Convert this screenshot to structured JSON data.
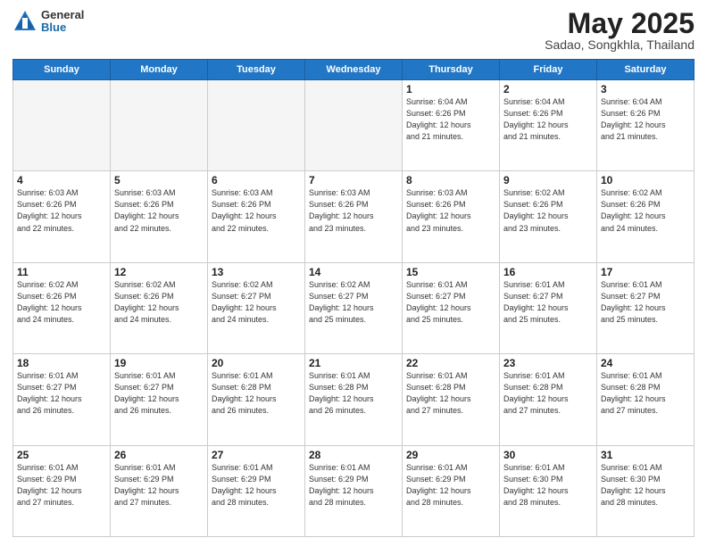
{
  "logo": {
    "general": "General",
    "blue": "Blue"
  },
  "title": {
    "month": "May 2025",
    "location": "Sadao, Songkhla, Thailand"
  },
  "weekdays": [
    "Sunday",
    "Monday",
    "Tuesday",
    "Wednesday",
    "Thursday",
    "Friday",
    "Saturday"
  ],
  "rows": [
    [
      {
        "day": "",
        "info": ""
      },
      {
        "day": "",
        "info": ""
      },
      {
        "day": "",
        "info": ""
      },
      {
        "day": "",
        "info": ""
      },
      {
        "day": "1",
        "info": "Sunrise: 6:04 AM\nSunset: 6:26 PM\nDaylight: 12 hours\nand 21 minutes."
      },
      {
        "day": "2",
        "info": "Sunrise: 6:04 AM\nSunset: 6:26 PM\nDaylight: 12 hours\nand 21 minutes."
      },
      {
        "day": "3",
        "info": "Sunrise: 6:04 AM\nSunset: 6:26 PM\nDaylight: 12 hours\nand 21 minutes."
      }
    ],
    [
      {
        "day": "4",
        "info": "Sunrise: 6:03 AM\nSunset: 6:26 PM\nDaylight: 12 hours\nand 22 minutes."
      },
      {
        "day": "5",
        "info": "Sunrise: 6:03 AM\nSunset: 6:26 PM\nDaylight: 12 hours\nand 22 minutes."
      },
      {
        "day": "6",
        "info": "Sunrise: 6:03 AM\nSunset: 6:26 PM\nDaylight: 12 hours\nand 22 minutes."
      },
      {
        "day": "7",
        "info": "Sunrise: 6:03 AM\nSunset: 6:26 PM\nDaylight: 12 hours\nand 23 minutes."
      },
      {
        "day": "8",
        "info": "Sunrise: 6:03 AM\nSunset: 6:26 PM\nDaylight: 12 hours\nand 23 minutes."
      },
      {
        "day": "9",
        "info": "Sunrise: 6:02 AM\nSunset: 6:26 PM\nDaylight: 12 hours\nand 23 minutes."
      },
      {
        "day": "10",
        "info": "Sunrise: 6:02 AM\nSunset: 6:26 PM\nDaylight: 12 hours\nand 24 minutes."
      }
    ],
    [
      {
        "day": "11",
        "info": "Sunrise: 6:02 AM\nSunset: 6:26 PM\nDaylight: 12 hours\nand 24 minutes."
      },
      {
        "day": "12",
        "info": "Sunrise: 6:02 AM\nSunset: 6:26 PM\nDaylight: 12 hours\nand 24 minutes."
      },
      {
        "day": "13",
        "info": "Sunrise: 6:02 AM\nSunset: 6:27 PM\nDaylight: 12 hours\nand 24 minutes."
      },
      {
        "day": "14",
        "info": "Sunrise: 6:02 AM\nSunset: 6:27 PM\nDaylight: 12 hours\nand 25 minutes."
      },
      {
        "day": "15",
        "info": "Sunrise: 6:01 AM\nSunset: 6:27 PM\nDaylight: 12 hours\nand 25 minutes."
      },
      {
        "day": "16",
        "info": "Sunrise: 6:01 AM\nSunset: 6:27 PM\nDaylight: 12 hours\nand 25 minutes."
      },
      {
        "day": "17",
        "info": "Sunrise: 6:01 AM\nSunset: 6:27 PM\nDaylight: 12 hours\nand 25 minutes."
      }
    ],
    [
      {
        "day": "18",
        "info": "Sunrise: 6:01 AM\nSunset: 6:27 PM\nDaylight: 12 hours\nand 26 minutes."
      },
      {
        "day": "19",
        "info": "Sunrise: 6:01 AM\nSunset: 6:27 PM\nDaylight: 12 hours\nand 26 minutes."
      },
      {
        "day": "20",
        "info": "Sunrise: 6:01 AM\nSunset: 6:28 PM\nDaylight: 12 hours\nand 26 minutes."
      },
      {
        "day": "21",
        "info": "Sunrise: 6:01 AM\nSunset: 6:28 PM\nDaylight: 12 hours\nand 26 minutes."
      },
      {
        "day": "22",
        "info": "Sunrise: 6:01 AM\nSunset: 6:28 PM\nDaylight: 12 hours\nand 27 minutes."
      },
      {
        "day": "23",
        "info": "Sunrise: 6:01 AM\nSunset: 6:28 PM\nDaylight: 12 hours\nand 27 minutes."
      },
      {
        "day": "24",
        "info": "Sunrise: 6:01 AM\nSunset: 6:28 PM\nDaylight: 12 hours\nand 27 minutes."
      }
    ],
    [
      {
        "day": "25",
        "info": "Sunrise: 6:01 AM\nSunset: 6:29 PM\nDaylight: 12 hours\nand 27 minutes."
      },
      {
        "day": "26",
        "info": "Sunrise: 6:01 AM\nSunset: 6:29 PM\nDaylight: 12 hours\nand 27 minutes."
      },
      {
        "day": "27",
        "info": "Sunrise: 6:01 AM\nSunset: 6:29 PM\nDaylight: 12 hours\nand 28 minutes."
      },
      {
        "day": "28",
        "info": "Sunrise: 6:01 AM\nSunset: 6:29 PM\nDaylight: 12 hours\nand 28 minutes."
      },
      {
        "day": "29",
        "info": "Sunrise: 6:01 AM\nSunset: 6:29 PM\nDaylight: 12 hours\nand 28 minutes."
      },
      {
        "day": "30",
        "info": "Sunrise: 6:01 AM\nSunset: 6:30 PM\nDaylight: 12 hours\nand 28 minutes."
      },
      {
        "day": "31",
        "info": "Sunrise: 6:01 AM\nSunset: 6:30 PM\nDaylight: 12 hours\nand 28 minutes."
      }
    ]
  ]
}
